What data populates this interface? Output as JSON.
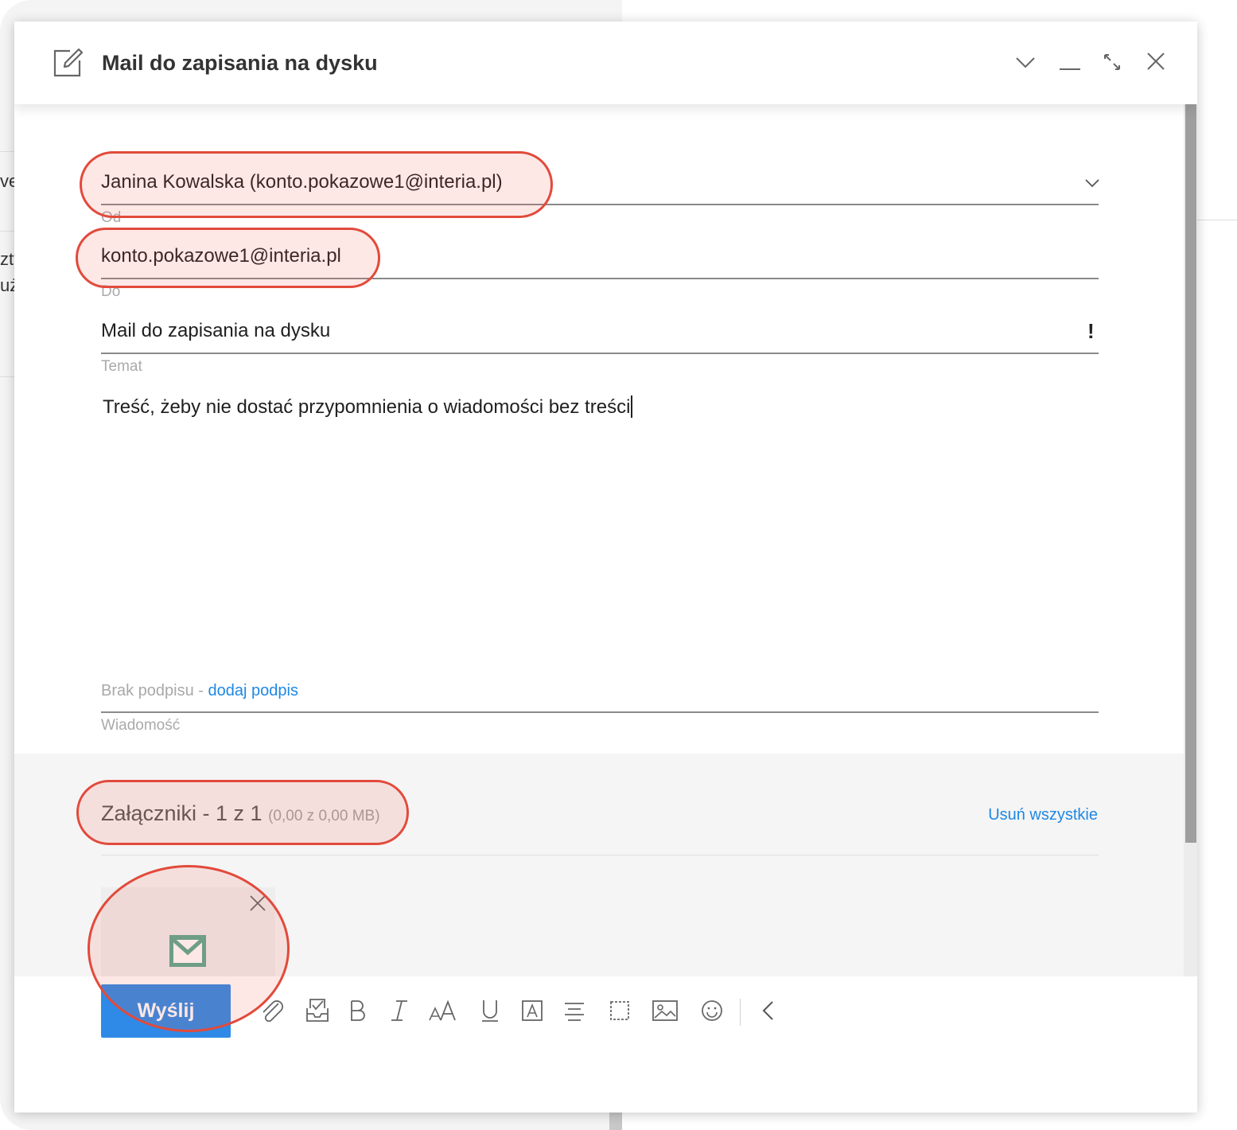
{
  "background": {
    "fragment_1": "ve",
    "fragment_2": "zty",
    "fragment_3": "uż"
  },
  "compose": {
    "title": "Mail do zapisania na dysku",
    "from_value": "Janina Kowalska (konto.pokazowe1@interia.pl)",
    "from_label": "Od",
    "to_value": "konto.pokazowe1@interia.pl",
    "to_label": "Do",
    "subject_value": "Mail do zapisania na dysku",
    "subject_label": "Temat",
    "priority_mark": "!",
    "body_text": "Treść, żeby nie dostać przypomnienia o wiadomości bez treści",
    "signature_text": "Brak podpisu - ",
    "signature_link": "dodaj podpis",
    "message_label": "Wiadomość"
  },
  "attachments": {
    "title": "Załączniki - 1 z 1",
    "size": "(0,00 z 0,00 MB)",
    "remove_all": "Usuń wszystkie",
    "items": [
      {
        "icon": "envelope-icon",
        "color": "#5aa890"
      }
    ]
  },
  "toolbar": {
    "send_label": "Wyślij",
    "icons": [
      "paperclip-icon",
      "inbox-icon",
      "bold-icon",
      "italic-icon",
      "font-size-icon",
      "underline-icon",
      "text-color-icon",
      "align-icon",
      "border-icon",
      "image-icon",
      "emoji-icon",
      "collapse-icon"
    ]
  },
  "colors": {
    "accent": "#2e8ae6",
    "link": "#1e88e5",
    "highlight": "#e24a3b"
  }
}
